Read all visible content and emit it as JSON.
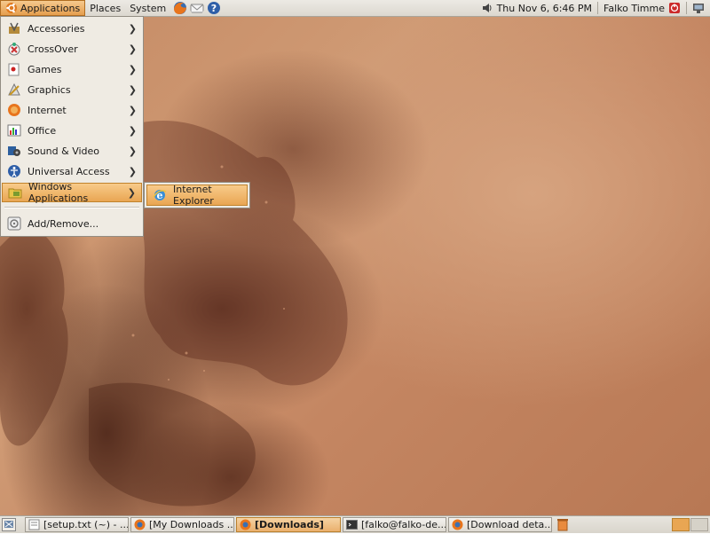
{
  "top_panel": {
    "menus": [
      "Applications",
      "Places",
      "System"
    ],
    "clock": "Thu Nov  6,  6:46 PM",
    "user": "Falko Timme"
  },
  "apps_menu": {
    "items": [
      {
        "label": "Accessories",
        "icon": "accessories-icon"
      },
      {
        "label": "CrossOver",
        "icon": "crossover-icon"
      },
      {
        "label": "Games",
        "icon": "games-icon"
      },
      {
        "label": "Graphics",
        "icon": "graphics-icon"
      },
      {
        "label": "Internet",
        "icon": "internet-icon"
      },
      {
        "label": "Office",
        "icon": "office-icon"
      },
      {
        "label": "Sound & Video",
        "icon": "sound-video-icon"
      },
      {
        "label": "Universal Access",
        "icon": "universal-access-icon"
      },
      {
        "label": "Windows Applications",
        "icon": "windows-applications-icon"
      }
    ],
    "add_remove": "Add/Remove...",
    "selected": "Windows Applications"
  },
  "submenu": {
    "items": [
      {
        "label": "Internet Explorer",
        "icon": "internet-explorer-icon"
      }
    ]
  },
  "taskbar": {
    "tasks": [
      {
        "label": "[setup.txt (~) - ..."
      },
      {
        "label": "[My Downloads ..."
      },
      {
        "label": "[Downloads]"
      },
      {
        "label": "[falko@falko-de..."
      },
      {
        "label": "[Download deta..."
      }
    ],
    "active": "[Downloads]"
  },
  "colors": {
    "accent": "#e9a653",
    "panel": "#dcd8cf",
    "wallpaper": "#c58a64"
  }
}
